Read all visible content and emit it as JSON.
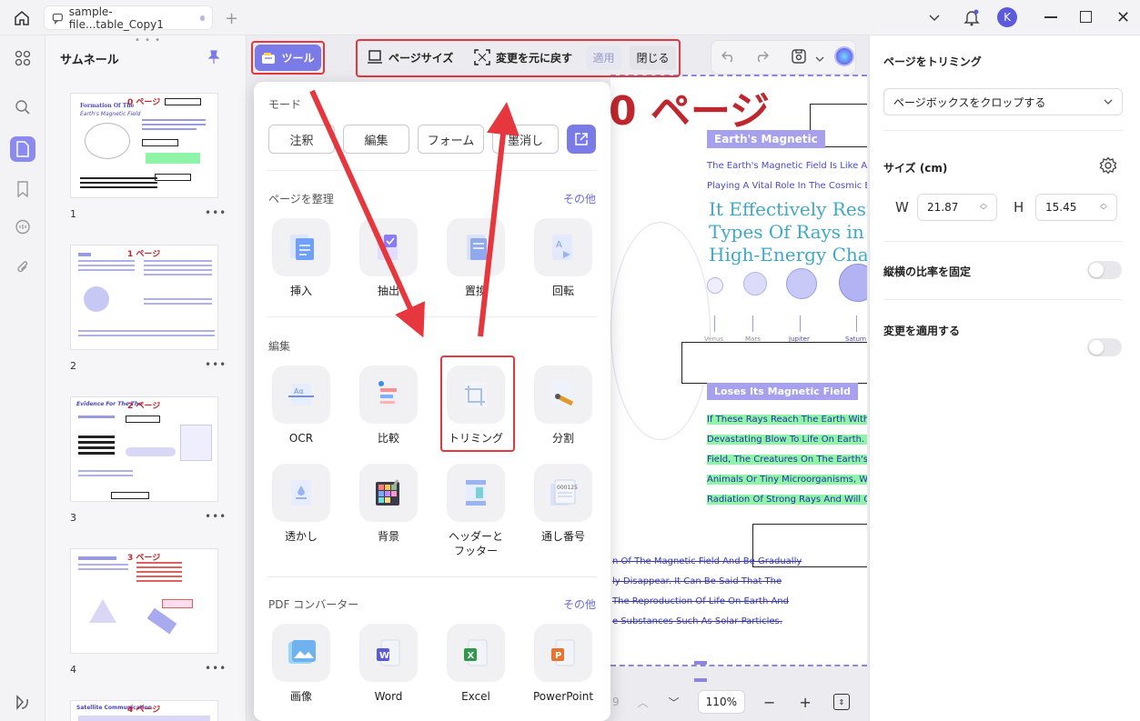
{
  "tab": {
    "title": "sample-file...table_Copy1"
  },
  "user": {
    "initial": "K"
  },
  "sidebar": {
    "title": "サムネール"
  },
  "thumbnails": [
    {
      "num": "1",
      "label": "0 ページ",
      "caption": "Formation Of The",
      "caption2": "Earth's Magnetic Field"
    },
    {
      "num": "2",
      "label": "1 ページ"
    },
    {
      "num": "3",
      "label": "2 ページ",
      "caption": "Evidence For The The"
    },
    {
      "num": "4",
      "label": "3 ページ"
    },
    {
      "label": "4 ページ",
      "caption": "Satellite Communication"
    }
  ],
  "toolbar": {
    "tools": "ツール",
    "page_size": "ページサイズ",
    "revert": "変更を元に戻す",
    "apply": "適用",
    "close": "閉じる"
  },
  "menu": {
    "mode_title": "モード",
    "modes": [
      "注釈",
      "編集",
      "フォーム",
      "墨消し"
    ],
    "organize_title": "ページを整理",
    "more": "その他",
    "organize": [
      "挿入",
      "抽出",
      "置換",
      "回転"
    ],
    "edit_title": "編集",
    "edit_row1": [
      "OCR",
      "比較",
      "トリミング",
      "分割"
    ],
    "edit_row2": [
      "透かし",
      "背景",
      "ヘッダーと\nフッター",
      "通し番号"
    ],
    "converter_title": "PDF コンバーター",
    "converter": [
      "画像",
      "Word",
      "Excel",
      "PowerPoint"
    ]
  },
  "document": {
    "page_label": "0 ページ",
    "heading1": "Earth's Magnetic",
    "line1": "The Earth's Magnetic Field Is Like A H",
    "line2": "Playing A Vital Role In The Cosmic En",
    "big1": "It Effectively Resis",
    "big2": "Types Of Rays in T",
    "big3": "High-Energy Charg",
    "planets": [
      "Venus",
      "Mars",
      "Jupiter",
      "Saturn"
    ],
    "heading2": "Loses Its Magnetic Field",
    "hl_lines": [
      "If These Rays Reach The Earth Withou",
      "Devastating Blow To Life On Earth. On",
      "Field, The Creatures On The Earth's S",
      "Animals Or Tiny Microorganisms, Will I",
      "Radiation Of Strong Rays And Will Qui"
    ],
    "strike_lines": [
      "n Of The Magnetic Field And Be Gradually",
      "ly Disappear. It Can Be Said That The",
      "The Reproduction Of Life On Earth And",
      "e Substances Such As Solar Particles."
    ]
  },
  "bottom": {
    "zoom": "110%",
    "page": "9"
  },
  "right_panel": {
    "title": "ページをトリミング",
    "crop_select": "ページボックスをクロップする",
    "size_label": "サイズ (cm)",
    "w_label": "W",
    "w_value": "21.87",
    "h_label": "H",
    "h_value": "15.45",
    "lock_ratio": "縦横の比率を固定",
    "apply_changes": "変更を適用する"
  },
  "colors": {
    "accent": "#8b8bef",
    "red": "#e5373d",
    "doc_red": "#c0262e"
  }
}
